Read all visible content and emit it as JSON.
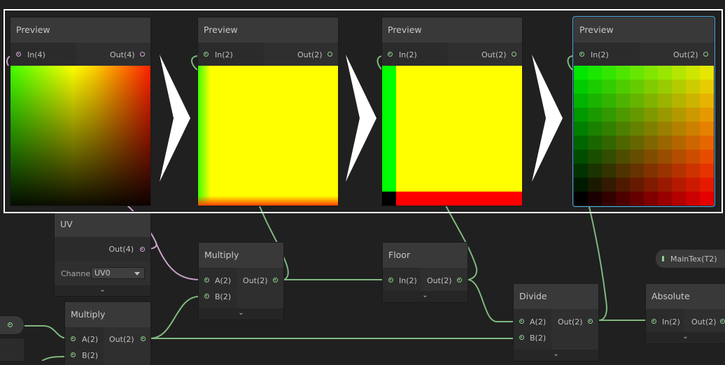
{
  "preview_nodes": [
    {
      "title": "Preview",
      "input": "In(4)",
      "output": "Out(4)"
    },
    {
      "title": "Preview",
      "input": "In(2)",
      "output": "Out(2)"
    },
    {
      "title": "Preview",
      "input": "In(2)",
      "output": "Out(2)"
    },
    {
      "title": "Preview",
      "input": "In(2)",
      "output": "Out(2)"
    }
  ],
  "uv_node": {
    "title": "UV",
    "output": "Out(4)",
    "channel_label": "Channe",
    "channel_value": "UV0"
  },
  "multiply_node_1": {
    "title": "Multiply",
    "input_a": "A(2)",
    "input_b": "B(2)",
    "output": "Out(2)"
  },
  "multiply_node_2": {
    "title": "Multiply",
    "input_a": "A(2)",
    "input_b": "B(2)",
    "output": "Out(2)"
  },
  "floor_node": {
    "title": "Floor",
    "input": "In(2)",
    "output": "Out(2)"
  },
  "divide_node": {
    "title": "Divide",
    "input_a": "A(2)",
    "input_b": "B(2)",
    "output": "Out(2)"
  },
  "absolute_node": {
    "title": "Absolute",
    "input": "In(2)",
    "output": "Out(2)"
  },
  "maintex_property": {
    "label": "MainTex(T2)"
  },
  "colors": {
    "wire_green": "#7fb87f",
    "wire_pink": "#c9a2c9",
    "selection": "#4aa6d9"
  }
}
